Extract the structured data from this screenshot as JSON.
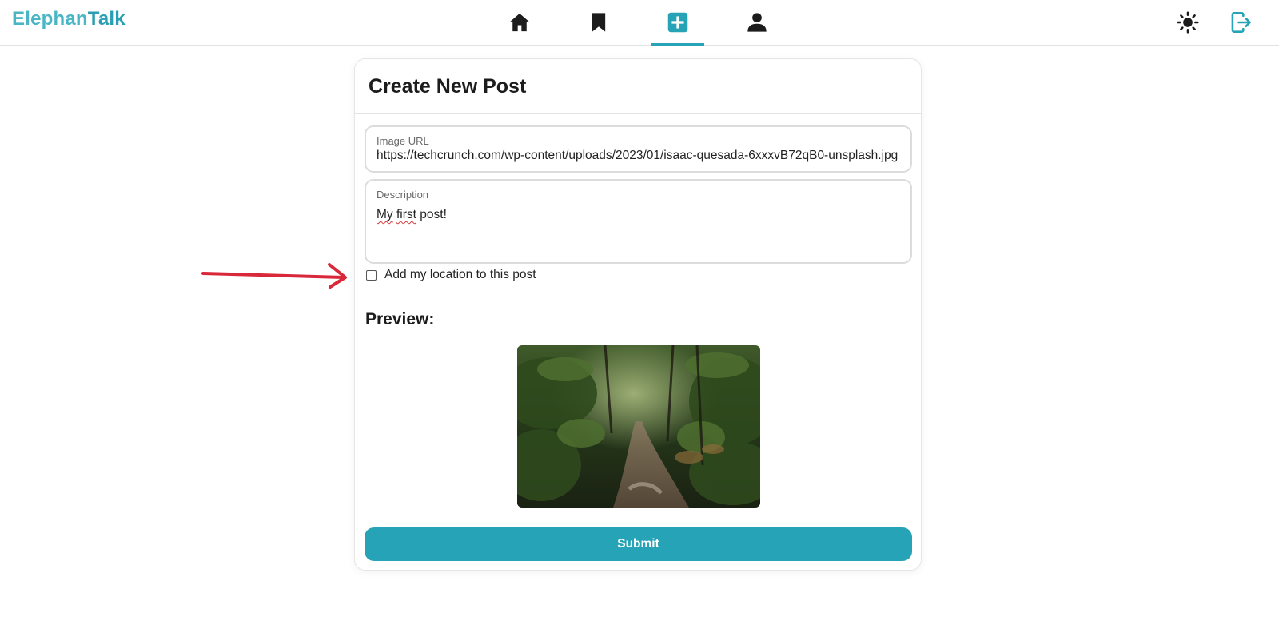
{
  "app": {
    "logo_part1": "Elephan",
    "logo_part2": "Talk"
  },
  "nav": {
    "icons": [
      "home-icon",
      "bookmark-icon",
      "add-post-icon",
      "profile-icon"
    ],
    "active": "add-post-icon",
    "right_icons": [
      "theme-toggle-sun-icon",
      "logout-icon"
    ]
  },
  "colors": {
    "accent": "#26a3b6",
    "logo_light": "#4ab5c4",
    "annotation_arrow": "#d8283a"
  },
  "form": {
    "title": "Create New Post",
    "image_url_label": "Image URL",
    "image_url_value": "https://techcrunch.com/wp-content/uploads/2023/01/isaac-quesada-6xxxvB72qB0-unsplash.jpg",
    "description_label": "Description",
    "description_word1": "My",
    "description_word2": "first",
    "description_rest": "post!",
    "location_checkbox_label": "Add my location to this post",
    "location_checked": false,
    "preview_title": "Preview:",
    "submit_label": "Submit"
  }
}
